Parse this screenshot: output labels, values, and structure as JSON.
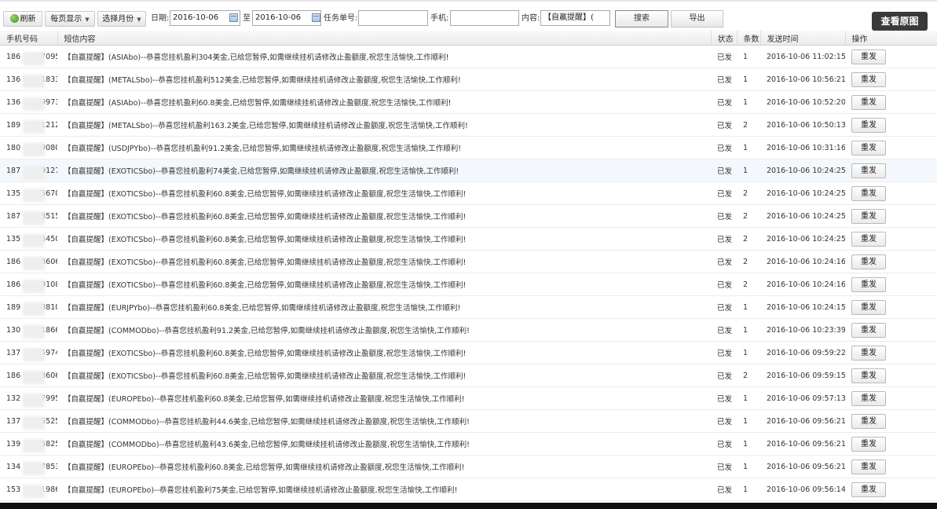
{
  "toolbar": {
    "refresh_label": "刷新",
    "per_page_label": "每页显示",
    "select_month_label": "选择月份",
    "date_label": "日期:",
    "date_from": "2016-10-06",
    "date_to_label": "至",
    "date_to": "2016-10-06",
    "task_no_label": "任务单号:",
    "task_no_value": "",
    "phone_label": "手机:",
    "phone_value": "",
    "content_label": "内容:",
    "content_value": "【自嬴提醒】(",
    "search_label": "搜索",
    "export_label": "导出",
    "view_original_label": "查看原图"
  },
  "table": {
    "headers": {
      "phone": "手机号码",
      "content": "短信内容",
      "status": "状态",
      "count": "条数",
      "time": "发送时间",
      "action": "操作"
    },
    "rows": [
      {
        "pa": "186",
        "pb": "7095",
        "content": "【自嬴提醒】(ASIAbo)--恭喜您挂机盈利304美金,已给您暂停,如需继续挂机请修改止盈额度,祝您生活愉快,工作顺利!",
        "status": "已发",
        "count": "1",
        "time": "2016-10-06 11:02:15",
        "action": "重发"
      },
      {
        "pa": "136",
        "pb": "1833",
        "content": "【自嬴提醒】(METALSbo)--恭喜您挂机盈利512美金,已给您暂停,如需继续挂机请修改止盈额度,祝您生活愉快,工作顺利!",
        "status": "已发",
        "count": "1",
        "time": "2016-10-06 10:56:21",
        "action": "重发"
      },
      {
        "pa": "136",
        "pb": "9973",
        "content": "【自嬴提醒】(ASIAbo)--恭喜您挂机盈利60.8美金,已给您暂停,如需继续挂机请修改止盈额度,祝您生活愉快,工作顺利!",
        "status": "已发",
        "count": "1",
        "time": "2016-10-06 10:52:20",
        "action": "重发"
      },
      {
        "pa": "189",
        "pb": "1212",
        "content": "【自嬴提醒】(METALSbo)--恭喜您挂机盈利163.2美金,已给您暂停,如需继续挂机请修改止盈额度,祝您生活愉快,工作顺利!",
        "status": "已发",
        "count": "2",
        "time": "2016-10-06 10:50:13",
        "action": "重发"
      },
      {
        "pa": "180",
        "pb": "9080",
        "content": "【自嬴提醒】(USDJPYbo)--恭喜您挂机盈利91.2美金,已给您暂停,如需继续挂机请修改止盈额度,祝您生活愉快,工作顺利!",
        "status": "已发",
        "count": "1",
        "time": "2016-10-06 10:31:16",
        "action": "重发"
      },
      {
        "pa": "187",
        "pb": "9127",
        "content": "【自嬴提醒】(EXOTICSbo)--恭喜您挂机盈利74美金,已给您暂停,如需继续挂机请修改止盈额度,祝您生活愉快,工作顺利!",
        "status": "已发",
        "count": "1",
        "time": "2016-10-06 10:24:25",
        "action": "重发"
      },
      {
        "pa": "135",
        "pb": "5670",
        "content": "【自嬴提醒】(EXOTICSbo)--恭喜您挂机盈利60.8美金,已给您暂停,如需继续挂机请修改止盈额度,祝您生活愉快,工作顺利!",
        "status": "已发",
        "count": "2",
        "time": "2016-10-06 10:24:25",
        "action": "重发"
      },
      {
        "pa": "187",
        "pb": "8515",
        "content": "【自嬴提醒】(EXOTICSbo)--恭喜您挂机盈利60.8美金,已给您暂停,如需继续挂机请修改止盈额度,祝您生活愉快,工作顺利!",
        "status": "已发",
        "count": "2",
        "time": "2016-10-06 10:24:25",
        "action": "重发"
      },
      {
        "pa": "135",
        "pb": "5450",
        "content": "【自嬴提醒】(EXOTICSbo)--恭喜您挂机盈利60.8美金,已给您暂停,如需继续挂机请修改止盈额度,祝您生活愉快,工作顺利!",
        "status": "已发",
        "count": "2",
        "time": "2016-10-06 10:24:25",
        "action": "重发"
      },
      {
        "pa": "186",
        "pb": "3606",
        "content": "【自嬴提醒】(EXOTICSbo)--恭喜您挂机盈利60.8美金,已给您暂停,如需继续挂机请修改止盈额度,祝您生活愉快,工作顺利!",
        "status": "已发",
        "count": "2",
        "time": "2016-10-06 10:24:16",
        "action": "重发"
      },
      {
        "pa": "186",
        "pb": "9108",
        "content": "【自嬴提醒】(EXOTICSbo)--恭喜您挂机盈利60.8美金,已给您暂停,如需继续挂机请修改止盈额度,祝您生活愉快,工作顺利!",
        "status": "已发",
        "count": "2",
        "time": "2016-10-06 10:24:16",
        "action": "重发"
      },
      {
        "pa": "189",
        "pb": "3810",
        "content": "【自嬴提醒】(EURJPYbo)--恭喜您挂机盈利60.8美金,已给您暂停,如需继续挂机请修改止盈额度,祝您生活愉快,工作顺利!",
        "status": "已发",
        "count": "1",
        "time": "2016-10-06 10:24:15",
        "action": "重发"
      },
      {
        "pa": "130",
        "pb": "1866",
        "content": "【自嬴提醒】(COMMODbo)--恭喜您挂机盈利91.2美金,已给您暂停,如需继续挂机请修改止盈额度,祝您生活愉快,工作顺利!",
        "status": "已发",
        "count": "1",
        "time": "2016-10-06 10:23:39",
        "action": "重发"
      },
      {
        "pa": "137",
        "pb": "5974",
        "content": "【自嬴提醒】(EXOTICSbo)--恭喜您挂机盈利60.8美金,已给您暂停,如需继续挂机请修改止盈额度,祝您生活愉快,工作顺利!",
        "status": "已发",
        "count": "1",
        "time": "2016-10-06 09:59:22",
        "action": "重发"
      },
      {
        "pa": "186",
        "pb": "3606",
        "content": "【自嬴提醒】(EXOTICSbo)--恭喜您挂机盈利60.8美金,已给您暂停,如需继续挂机请修改止盈额度,祝您生活愉快,工作顺利!",
        "status": "已发",
        "count": "2",
        "time": "2016-10-06 09:59:15",
        "action": "重发"
      },
      {
        "pa": "132",
        "pb": "7995",
        "content": "【自嬴提醒】(EUROPEbo)--恭喜您挂机盈利60.8美金,已给您暂停,如需继续挂机请修改止盈额度,祝您生活愉快,工作顺利!",
        "status": "已发",
        "count": "1",
        "time": "2016-10-06 09:57:13",
        "action": "重发"
      },
      {
        "pa": "137",
        "pb": "5525",
        "content": "【自嬴提醒】(COMMODbo)--恭喜您挂机盈利44.6美金,已给您暂停,如需继续挂机请修改止盈额度,祝您生活愉快,工作顺利!",
        "status": "已发",
        "count": "1",
        "time": "2016-10-06 09:56:21",
        "action": "重发"
      },
      {
        "pa": "139",
        "pb": "5825",
        "content": "【自嬴提醒】(COMMODbo)--恭喜您挂机盈利43.6美金,已给您暂停,如需继续挂机请修改止盈额度,祝您生活愉快,工作顺利!",
        "status": "已发",
        "count": "1",
        "time": "2016-10-06 09:56:21",
        "action": "重发"
      },
      {
        "pa": "134",
        "pb": "7853",
        "content": "【自嬴提醒】(EUROPEbo)--恭喜您挂机盈利60.8美金,已给您暂停,如需继续挂机请修改止盈额度,祝您生活愉快,工作顺利!",
        "status": "已发",
        "count": "1",
        "time": "2016-10-06 09:56:21",
        "action": "重发"
      },
      {
        "pa": "153",
        "pb": "1986",
        "content": "【自嬴提醒】(EUROPEbo)--恭喜您挂机盈利75美金,已给您暂停,如需继续挂机请修改止盈额度,祝您生活愉快,工作顺利!",
        "status": "已发",
        "count": "1",
        "time": "2016-10-06 09:56:14",
        "action": "重发"
      }
    ]
  }
}
